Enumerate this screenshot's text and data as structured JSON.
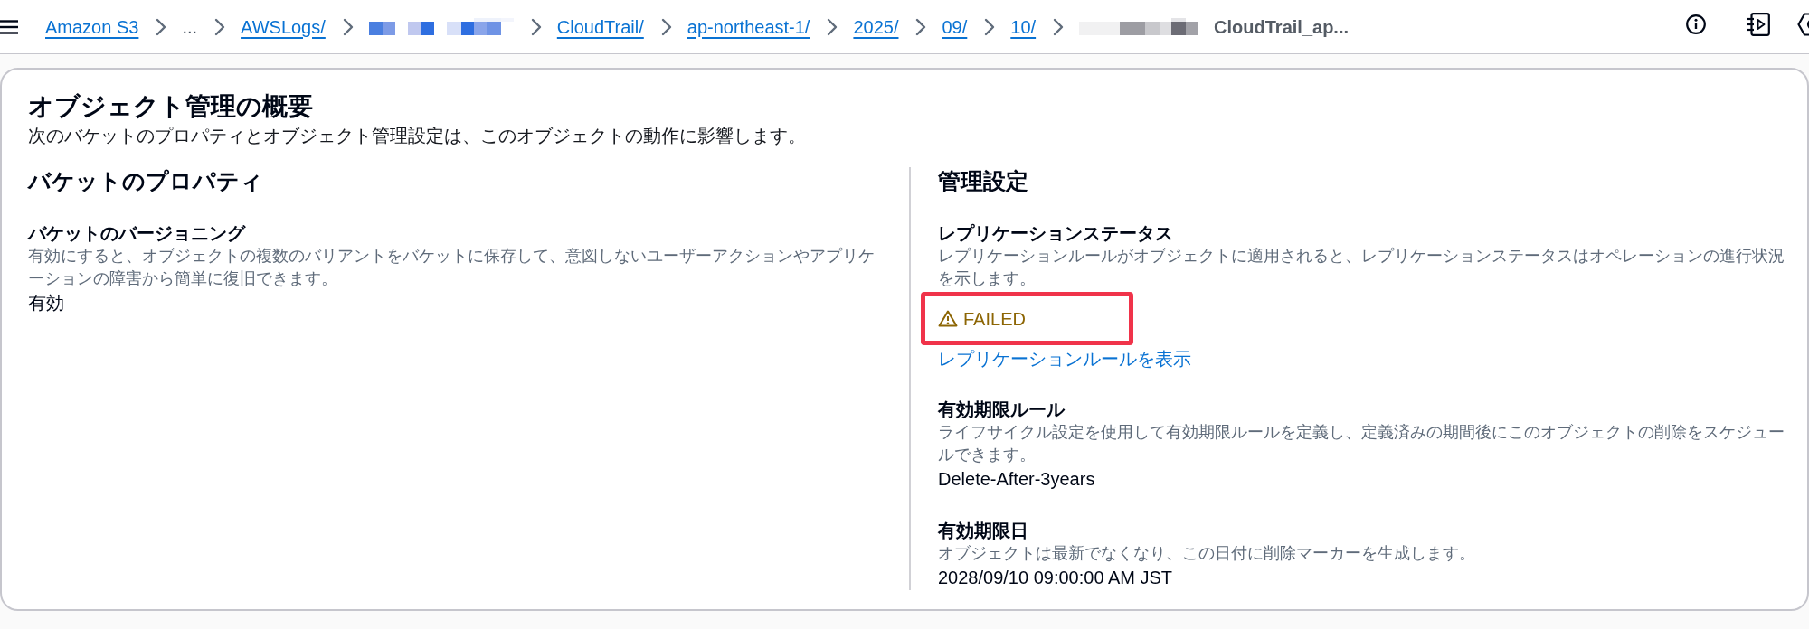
{
  "top_bar": {
    "breadcrumbs": [
      {
        "kind": "link",
        "label": "Amazon S3"
      },
      {
        "kind": "ellipsis",
        "label": "..."
      },
      {
        "kind": "link",
        "label": "AWSLogs/"
      },
      {
        "kind": "redacted"
      },
      {
        "kind": "link",
        "label": "CloudTrail/"
      },
      {
        "kind": "link",
        "label": "ap-northeast-1/"
      },
      {
        "kind": "link",
        "label": "2025/"
      },
      {
        "kind": "link",
        "label": "09/"
      },
      {
        "kind": "link",
        "label": "10/"
      },
      {
        "kind": "current",
        "redacted_prefix": true,
        "label": "CloudTrail_ap..."
      }
    ]
  },
  "panel": {
    "title": "オブジェクト管理の概要",
    "description": "次のバケットのプロパティとオブジェクト管理設定は、このオブジェクトの動作に影響します。",
    "columns": [
      {
        "heading": "バケットのプロパティ",
        "fields": [
          {
            "kind": "text",
            "label": "バケットのバージョニング",
            "description": "有効にすると、オブジェクトの複数のバリアントをバケットに保存して、意図しないユーザーアクションやアプリケーションの障害から簡単に復旧できます。",
            "value": "有効"
          }
        ]
      },
      {
        "heading": "管理設定",
        "fields": [
          {
            "kind": "status",
            "label": "レプリケーションステータス",
            "description": "レプリケーションルールがオブジェクトに適用されると、レプリケーションステータスはオペレーションの進行状況を示します。",
            "status": {
              "kind": "warning",
              "text": "FAILED",
              "highlighted": true
            },
            "link": "レプリケーションルールを表示"
          },
          {
            "kind": "text",
            "label": "有効期限ルール",
            "description": "ライフサイクル設定を使用して有効期限ルールを定義し、定義済みの期間後にこのオブジェクトの削除をスケジュールできます。",
            "value": "Delete-After-3years"
          },
          {
            "kind": "text",
            "label": "有効期限日",
            "description": "オブジェクトは最新でなくなり、この日付に削除マーカーを生成します。",
            "value": "2028/09/10 09:00:00 AM JST"
          }
        ]
      }
    ]
  }
}
